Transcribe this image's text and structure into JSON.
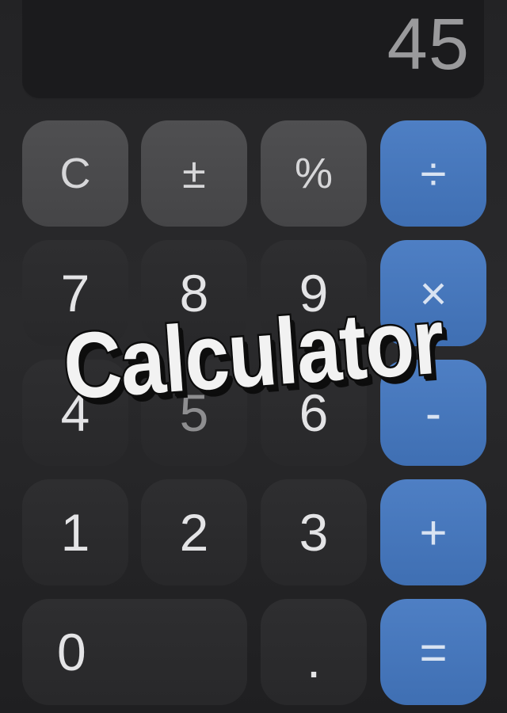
{
  "display": {
    "value": "45"
  },
  "keys": {
    "row1": [
      {
        "label": "C",
        "kind": "function"
      },
      {
        "label": "±",
        "kind": "function"
      },
      {
        "label": "%",
        "kind": "function"
      },
      {
        "label": "÷",
        "kind": "operator"
      }
    ],
    "row2": [
      {
        "label": "7",
        "kind": "digit"
      },
      {
        "label": "8",
        "kind": "digit"
      },
      {
        "label": "9",
        "kind": "digit"
      },
      {
        "label": "×",
        "kind": "operator"
      }
    ],
    "row3": [
      {
        "label": "4",
        "kind": "digit"
      },
      {
        "label": "5",
        "kind": "digit"
      },
      {
        "label": "6",
        "kind": "digit"
      },
      {
        "label": "-",
        "kind": "operator"
      }
    ],
    "row4": [
      {
        "label": "1",
        "kind": "digit"
      },
      {
        "label": "2",
        "kind": "digit"
      },
      {
        "label": "3",
        "kind": "digit"
      },
      {
        "label": "+",
        "kind": "operator"
      }
    ],
    "row5": [
      {
        "label": "0",
        "kind": "digit"
      },
      {
        "label": ".",
        "kind": "digit"
      },
      {
        "label": "=",
        "kind": "operator"
      }
    ]
  },
  "overlay": {
    "title": "Calculator"
  },
  "colors": {
    "operator": "#4a7bc0",
    "function": "#4c4c4e",
    "digit": "#2c2c2e",
    "display_text": "#9a9a9c"
  }
}
